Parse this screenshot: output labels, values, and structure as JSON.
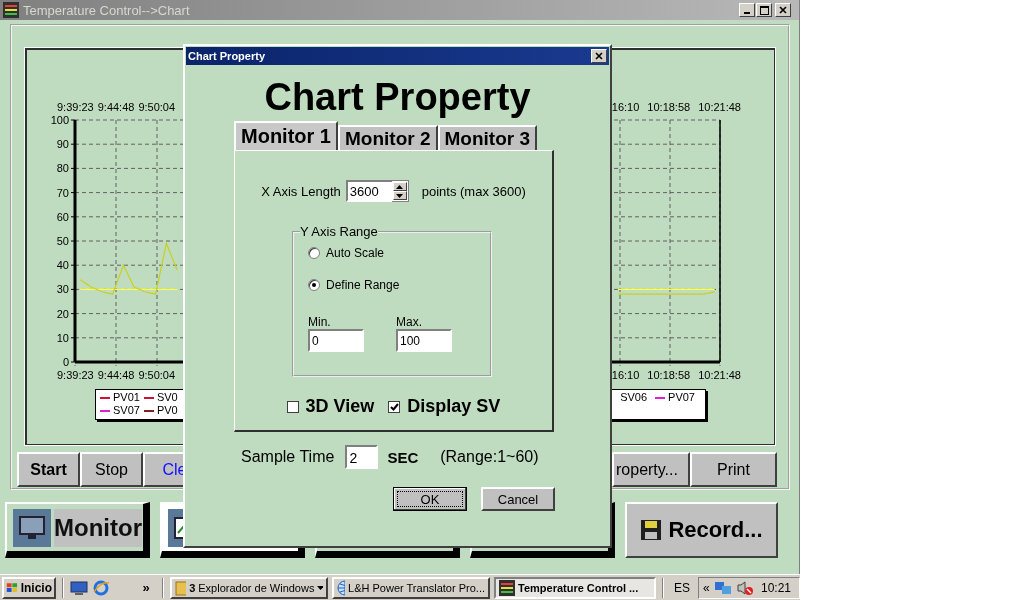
{
  "window": {
    "title": "Temperature Control-->Chart"
  },
  "chart": {
    "top_labels_left": [
      "9:39:23",
      "9:44:48",
      "9:50:04"
    ],
    "top_labels_right": [
      "16:10",
      "10:18:58",
      "10:21:48"
    ],
    "chart_data": {
      "type": "line",
      "grid": true,
      "ylim": [
        0,
        100
      ],
      "yticks": [
        0,
        10,
        20,
        30,
        40,
        50,
        60,
        70,
        80,
        90,
        100
      ],
      "series": [
        {
          "color": "#ffff40",
          "values": [
            30,
            30,
            30,
            30,
            30,
            30,
            30,
            30,
            30,
            30,
            null,
            null,
            null,
            null,
            null,
            null,
            null,
            null,
            null,
            null,
            null,
            null,
            null,
            null,
            null,
            null,
            null,
            null,
            null,
            null,
            null,
            null,
            null,
            null,
            null,
            null,
            null,
            null,
            null,
            null,
            null,
            null,
            null,
            null,
            null,
            null,
            null,
            null,
            null,
            null,
            30,
            30,
            30,
            30,
            30,
            30,
            30,
            30,
            30,
            30
          ]
        },
        {
          "color": "#c8d020",
          "values": [
            34,
            31,
            29,
            28,
            40,
            31,
            29,
            28,
            49,
            38,
            null,
            null,
            null,
            null,
            null,
            null,
            null,
            null,
            null,
            null,
            null,
            null,
            null,
            null,
            null,
            null,
            null,
            null,
            null,
            null,
            null,
            null,
            null,
            null,
            null,
            null,
            null,
            null,
            null,
            null,
            null,
            null,
            null,
            null,
            null,
            null,
            null,
            null,
            null,
            null,
            28,
            28,
            28,
            28,
            28,
            28,
            28,
            28,
            28,
            29
          ]
        }
      ]
    },
    "bottom_labels_left": [
      "9:39:23",
      "9:44:48",
      "9:50:04"
    ],
    "bottom_labels_right": [
      "16:10",
      "10:18:58",
      "10:21:48"
    ],
    "legend_left": [
      {
        "label": "PV01",
        "color": "#d01030"
      },
      {
        "label": "SV0",
        "color": "#d01030"
      },
      {
        "label": "SV07",
        "color": "#e020d0"
      },
      {
        "label": "PV0",
        "color": "#802020"
      }
    ],
    "legend_right": [
      {
        "label": "SV06"
      },
      {
        "label": "PV07",
        "color": "#e020d0"
      }
    ]
  },
  "toolbar_left": [
    {
      "label": "Start",
      "kind": "bold"
    },
    {
      "label": "Stop",
      "kind": "plain"
    },
    {
      "label": "Cle",
      "kind": "blue"
    }
  ],
  "toolbar_right": [
    {
      "label": "roperty...",
      "kind": "plain"
    },
    {
      "label": "Print",
      "kind": "plain"
    }
  ],
  "nav": [
    {
      "label": "Monitor",
      "kind": "tab",
      "selected": false
    },
    {
      "kind": "tab",
      "selected": true
    },
    {
      "kind": "tab",
      "selected": false
    },
    {
      "kind": "tab",
      "selected": false
    },
    {
      "label": "Record...",
      "kind": "action"
    }
  ],
  "dialog": {
    "title": "Chart Property",
    "heading": "Chart Property",
    "tabs": [
      {
        "label": "Monitor 1",
        "selected": true
      },
      {
        "label": "Monitor 2",
        "selected": false
      },
      {
        "label": "Monitor 3",
        "selected": false
      }
    ],
    "x_axis": {
      "label": "X Axis Length",
      "value": "3600",
      "hint": "points (max 3600)"
    },
    "y_axis": {
      "legend": "Y Axis Range",
      "options": [
        {
          "label": "Auto Scale",
          "selected": false
        },
        {
          "label": "Define Range",
          "selected": true
        }
      ],
      "min": {
        "label": "Min.",
        "value": "0"
      },
      "max": {
        "label": "Max.",
        "value": "100"
      }
    },
    "checks": [
      {
        "label": "3D View",
        "checked": false
      },
      {
        "label": "Display SV",
        "checked": true
      }
    ],
    "sample": {
      "label": "Sample Time",
      "value": "2",
      "unit": "SEC",
      "range": "(Range:1~60)"
    },
    "buttons": [
      {
        "label": "OK",
        "focused": true
      },
      {
        "label": "Cancel",
        "focused": false
      }
    ]
  },
  "taskbar": {
    "start": "Inicio",
    "chevron": "»",
    "tasks": [
      {
        "count": "3",
        "label": "Explorador de Windows",
        "kind": "group",
        "selected": false
      },
      {
        "label": "L&H Power Translator Pro...",
        "kind": "app",
        "selected": false
      },
      {
        "label": "Temperature Control ...",
        "kind": "app",
        "selected": true
      }
    ],
    "language": "ES",
    "tray_chevron": "«",
    "clock": "10:21"
  }
}
